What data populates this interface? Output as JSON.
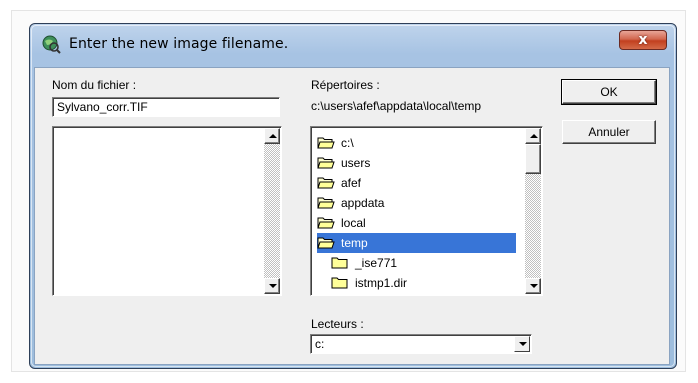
{
  "dialog": {
    "title": "Enter the new image filename.",
    "close_label": "x",
    "colors": {
      "selection": "#3875d7",
      "face": "#efefef",
      "titlebar": "#a7c3e3",
      "close": "#c2401f"
    }
  },
  "file_section": {
    "label": "Nom du fichier :",
    "filename_value": "Sylvano_corr.TIF",
    "files": []
  },
  "dir_section": {
    "label": "Répertoires :",
    "current_path": "c:\\users\\afef\\appdata\\local\\temp",
    "items": [
      {
        "name": "c:\\",
        "icon": "open-folder-icon",
        "selected": false
      },
      {
        "name": "users",
        "icon": "open-folder-icon",
        "selected": false
      },
      {
        "name": "afef",
        "icon": "open-folder-icon",
        "selected": false
      },
      {
        "name": "appdata",
        "icon": "open-folder-icon",
        "selected": false
      },
      {
        "name": "local",
        "icon": "open-folder-icon",
        "selected": false
      },
      {
        "name": "temp",
        "icon": "open-folder-icon",
        "selected": true
      },
      {
        "name": "_ise771",
        "icon": "closed-folder-icon",
        "selected": false
      },
      {
        "name": "istmp1.dir",
        "icon": "closed-folder-icon",
        "selected": false
      }
    ]
  },
  "drive_section": {
    "label": "Lecteurs :",
    "selected_drive": "c:"
  },
  "buttons": {
    "ok": "OK",
    "cancel": "Annuler"
  }
}
